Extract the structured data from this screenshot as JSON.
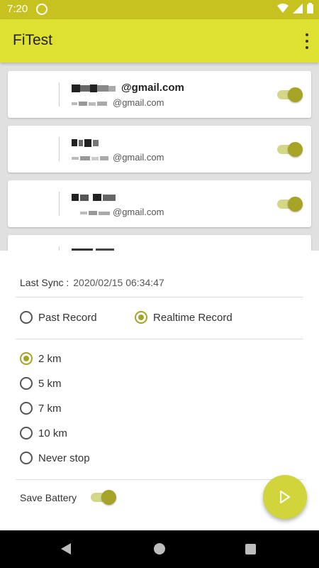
{
  "status_bar": {
    "time": "7:20",
    "icons": [
      "sync-icon",
      "wifi-icon",
      "signal-icon",
      "battery-icon"
    ]
  },
  "app_bar": {
    "title": "FiTest"
  },
  "accounts": [
    {
      "name": "@gmail.com",
      "email": "@gmail.com",
      "enabled": true
    },
    {
      "name": "",
      "email": "@gmail.com",
      "enabled": true
    },
    {
      "name": "",
      "email": "@gmail.com",
      "enabled": true
    }
  ],
  "sync": {
    "label": "Last Sync :",
    "value": "2020/02/15 06:34:47"
  },
  "record_mode": {
    "options": [
      "Past Record",
      "Realtime Record"
    ],
    "selected": "Realtime Record"
  },
  "distance": {
    "options": [
      "2 km",
      "5 km",
      "7 km",
      "10 km",
      "Never stop"
    ],
    "selected": "2 km"
  },
  "battery": {
    "label": "Save Battery",
    "enabled": true
  },
  "colors": {
    "accent": "#a6a427",
    "app_bar": "#dfe131",
    "status_bar": "#c7c21f"
  }
}
